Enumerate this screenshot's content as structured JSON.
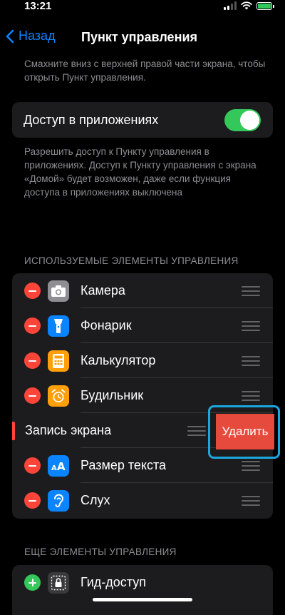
{
  "status": {
    "time": "13:21"
  },
  "nav": {
    "back_label": "Назад",
    "title": "Пункт управления"
  },
  "top_hint": "Смахните вниз с верхней правой части экрана, чтобы открыть Пункт управления.",
  "access": {
    "label": "Доступ в приложениях",
    "enabled": true,
    "hint": "Разрешить доступ к Пункту управления в приложениях. Доступ к Пункту управления с экрана «Домой» будет возможен, даже если функция доступа в приложениях выключена"
  },
  "included": {
    "header": "ИСПОЛЬЗУЕМЫЕ ЭЛЕМЕНТЫ УПРАВЛЕНИЯ",
    "items": [
      {
        "label": "Камера",
        "icon": "camera-icon",
        "icon_color": "#8e8e93"
      },
      {
        "label": "Фонарик",
        "icon": "flashlight-icon",
        "icon_color": "#0a84ff"
      },
      {
        "label": "Калькулятор",
        "icon": "calculator-icon",
        "icon_color": "#ff9f0a"
      },
      {
        "label": "Будильник",
        "icon": "alarm-icon",
        "icon_color": "#ff9f0a"
      },
      {
        "label": "Запись экрана",
        "icon": "screen-record-icon",
        "icon_color": "#ff453a"
      },
      {
        "label": "Размер текста",
        "icon": "text-size-icon",
        "icon_color": "#0a84ff"
      },
      {
        "label": "Слух",
        "icon": "hearing-icon",
        "icon_color": "#0a84ff"
      }
    ],
    "delete_label": "Удалить"
  },
  "more": {
    "header": "ЕЩЕ ЭЛЕМЕНТЫ УПРАВЛЕНИЯ",
    "items": [
      {
        "label": "Гид-доступ",
        "icon": "guided-access-icon",
        "icon_color": "#3a3a3c"
      }
    ]
  },
  "colors": {
    "accent": "#0a84ff",
    "toggle_on": "#34c759",
    "destructive": "#ff453a",
    "highlight_frame": "#1aa7e0"
  }
}
